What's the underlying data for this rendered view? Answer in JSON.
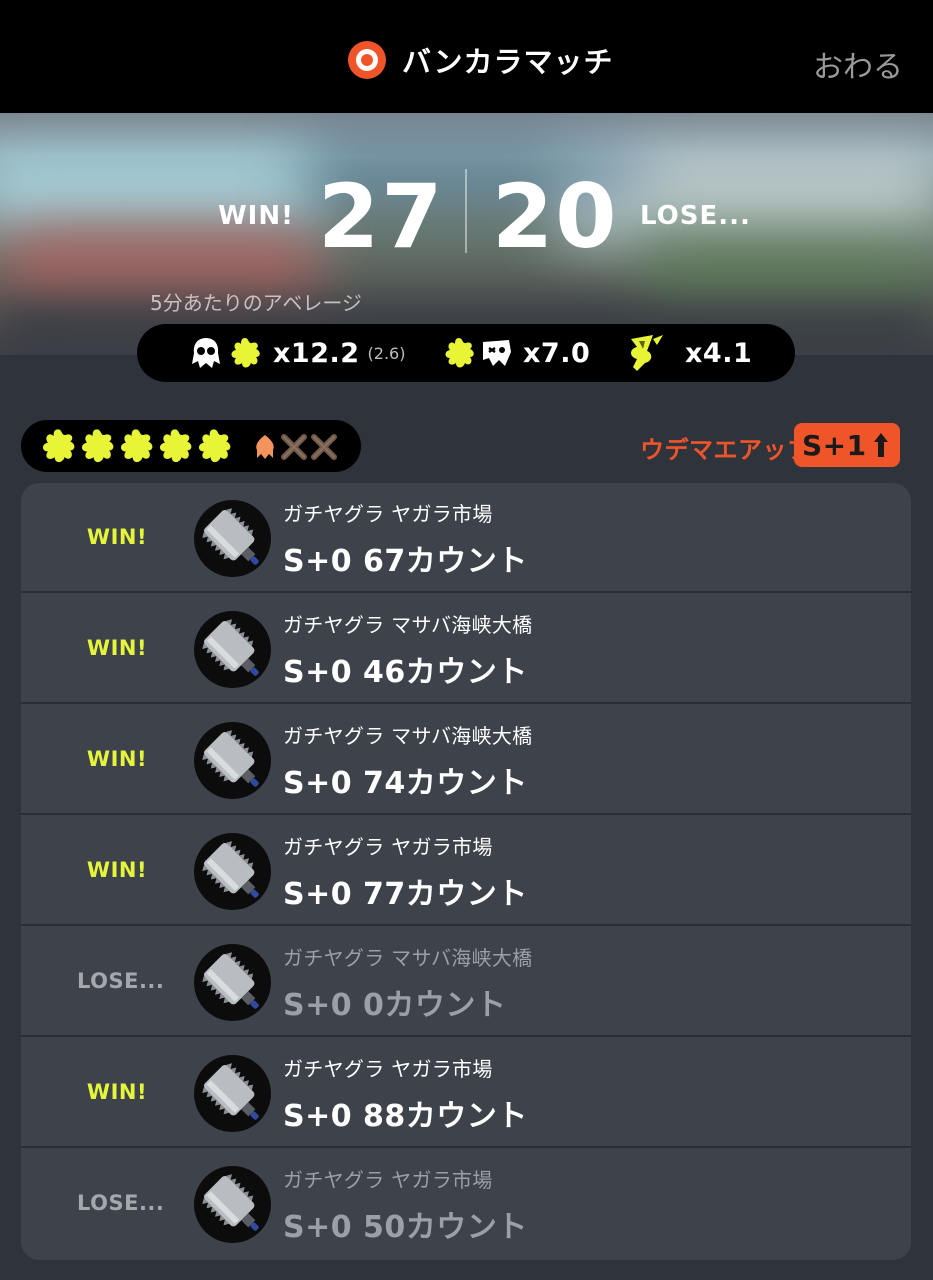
{
  "header": {
    "title": "バンカラマッチ",
    "close_label": "おわる"
  },
  "score": {
    "win_label": "WIN!",
    "lose_label": "LOSE...",
    "our": "27",
    "their": "20"
  },
  "stats": {
    "caption": "5分あたりのアベレージ",
    "kill_assist": "x12.2",
    "assist": "(2.6)",
    "death": "x7.0",
    "special": "x4.1"
  },
  "progress": {
    "wins": 5,
    "losses": 2,
    "rankup_label": "ウデマエアップ!",
    "rankup_badge": "S+1"
  },
  "matches": [
    {
      "result": "WIN!",
      "mode": "ガチヤグラ ヤガラ市場",
      "rank": "S+0 67カウント"
    },
    {
      "result": "WIN!",
      "mode": "ガチヤグラ マサバ海峡大橋",
      "rank": "S+0 46カウント"
    },
    {
      "result": "WIN!",
      "mode": "ガチヤグラ マサバ海峡大橋",
      "rank": "S+0 74カウント"
    },
    {
      "result": "WIN!",
      "mode": "ガチヤグラ ヤガラ市場",
      "rank": "S+0 77カウント"
    },
    {
      "result": "LOSE...",
      "mode": "ガチヤグラ マサバ海峡大橋",
      "rank": "S+0 0カウント"
    },
    {
      "result": "WIN!",
      "mode": "ガチヤグラ ヤガラ市場",
      "rank": "S+0 88カウント"
    },
    {
      "result": "LOSE...",
      "mode": "ガチヤグラ ヤガラ市場",
      "rank": "S+0 50カウント"
    }
  ],
  "colors": {
    "accent_orange": "#f0552a",
    "win_yellow": "#e5f63a",
    "lose_gray": "#a4a8ad",
    "ink_yellow": "#e8f536"
  },
  "icons": {
    "header": "bankara-emblem-icon",
    "kill": "squid-kill-icon",
    "death": "squid-death-icon",
    "special": "special-weapon-icon",
    "weapon": "dynamo-roller-icon"
  }
}
